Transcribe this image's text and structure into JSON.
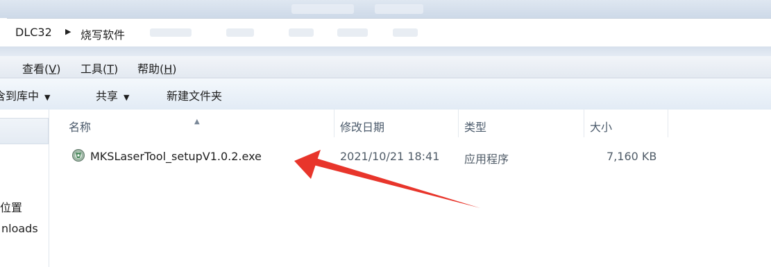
{
  "breadcrumb": {
    "items": [
      "DLC32",
      "烧写软件"
    ]
  },
  "menu": {
    "items": [
      {
        "label": "查看(",
        "key": "V",
        "tail": ")"
      },
      {
        "label": "工具(",
        "key": "T",
        "tail": ")"
      },
      {
        "label": "帮助(",
        "key": "H",
        "tail": ")"
      }
    ]
  },
  "toolbar": {
    "include_label": "含到库中",
    "share_label": "共享",
    "new_folder_label": "新建文件夹",
    "dropdown_glyph": "▼"
  },
  "nav": {
    "items": [
      "的位置",
      "nloads"
    ]
  },
  "columns": {
    "name": "名称",
    "modified": "修改日期",
    "type": "类型",
    "size": "大小"
  },
  "files": [
    {
      "name": "MKSLaserTool_setupV1.0.2.exe",
      "modified": "2021/10/21 18:41",
      "type": "应用程序",
      "size": "7,160 KB",
      "icon": "installer-disc-icon"
    }
  ],
  "colors": {
    "annotation_arrow": "#e8352b",
    "header_text": "#4b5a6b"
  }
}
